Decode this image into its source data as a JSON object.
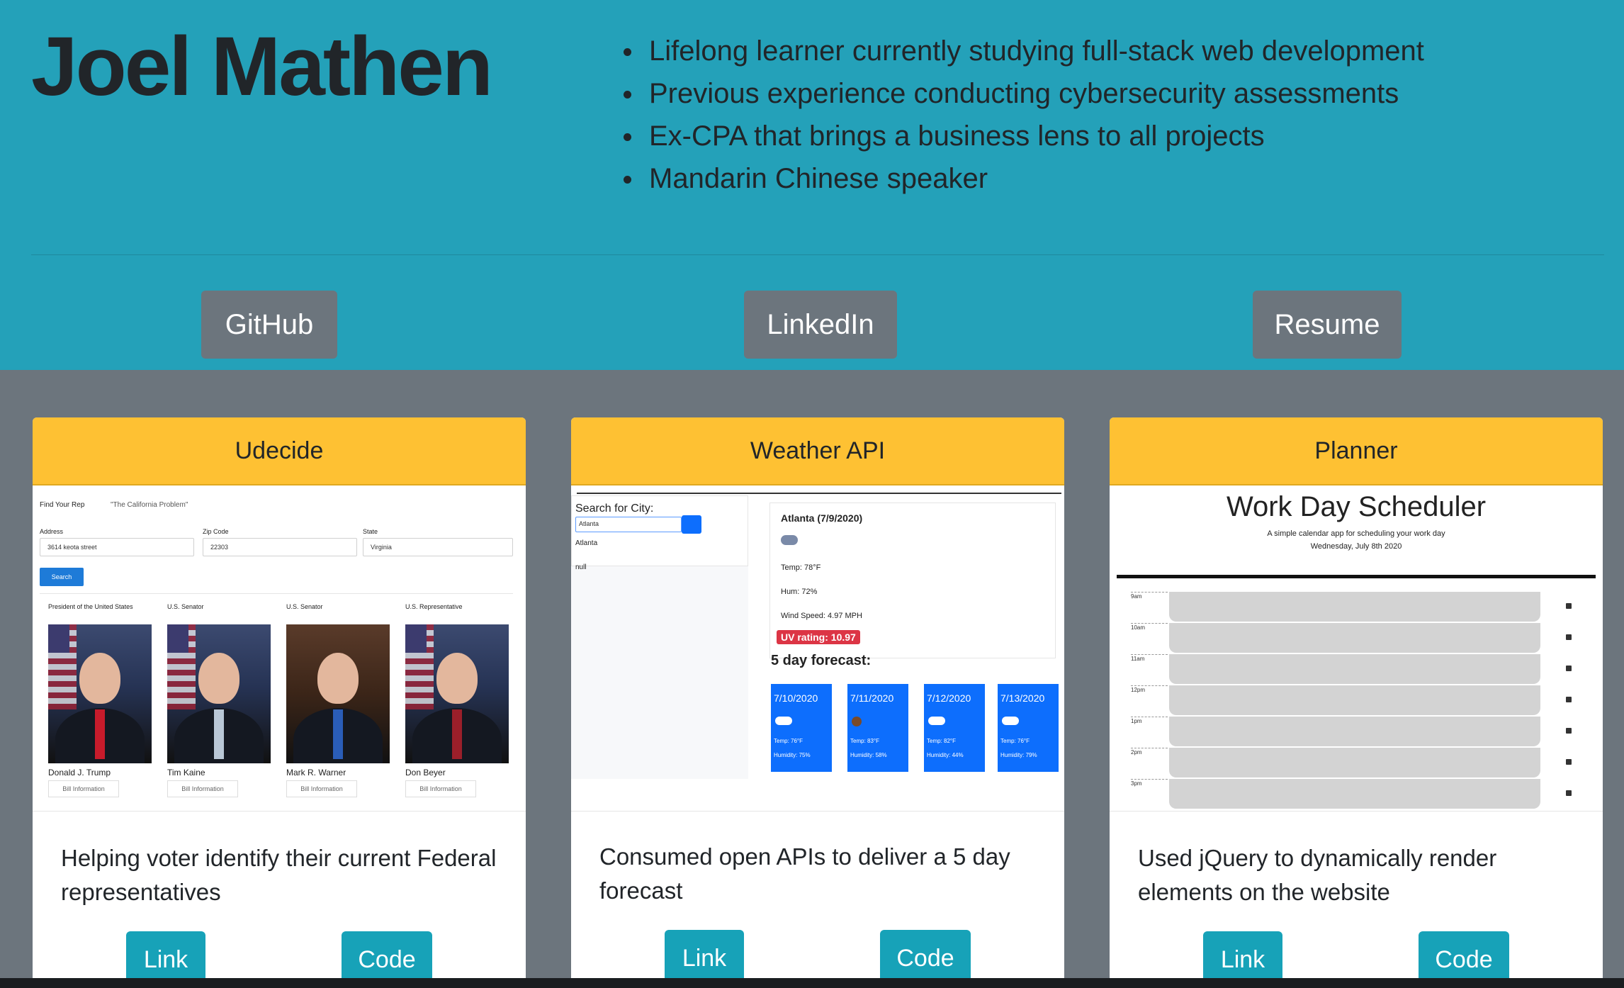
{
  "header": {
    "name": "Joel Mathen",
    "bullets": [
      "Lifelong learner currently studying full-stack web development",
      "Previous experience conducting cybersecurity assessments",
      "Ex-CPA that brings a business lens to all projects",
      "Mandarin Chinese speaker"
    ],
    "buttons": {
      "github": "GitHub",
      "linkedin": "LinkedIn",
      "resume": "Resume"
    }
  },
  "colors": {
    "hero": "#24a1b9",
    "page": "#6c757d",
    "card_header": "#fec133",
    "teal_button": "#17a2b8",
    "gray_button": "#6c757d"
  },
  "projects": [
    {
      "title": "Udecide",
      "description": "Helping voter identify their current Federal representatives",
      "link_label": "Link",
      "code_label": "Code",
      "preview": {
        "tabs": [
          "Find Your Rep",
          "\"The California Problem\""
        ],
        "fields": [
          {
            "label": "Address",
            "value": "3614 keota street"
          },
          {
            "label": "Zip Code",
            "value": "22303"
          },
          {
            "label": "State",
            "value": "Virginia"
          }
        ],
        "search_button": "Search",
        "reps": [
          {
            "office": "President of the United States",
            "name": "Donald J. Trump",
            "button": "Bill Information"
          },
          {
            "office": "U.S. Senator",
            "name": "Tim Kaine",
            "button": "Bill Information"
          },
          {
            "office": "U.S. Senator",
            "name": "Mark R. Warner",
            "button": "Bill Information"
          },
          {
            "office": "U.S. Representative",
            "name": "Don Beyer",
            "button": "Bill Information"
          }
        ]
      }
    },
    {
      "title": "Weather API",
      "description": "Consumed open APIs to deliver a 5 day forecast",
      "link_label": "Link",
      "code_label": "Code",
      "preview": {
        "search_label": "Search for City:",
        "search_value": "Atlanta",
        "history": [
          "Atlanta",
          "null"
        ],
        "city_date": "Atlanta (7/9/2020)",
        "temp": "Temp: 78°F",
        "hum": "Hum: 72%",
        "wind": "Wind Speed: 4.97 MPH",
        "uv": "UV rating: 10.97",
        "forecast_title": "5 day forecast:",
        "forecast": [
          {
            "date": "7/10/2020",
            "temp": "Temp: 76°F",
            "hum": "Humidity: 75%"
          },
          {
            "date": "7/11/2020",
            "temp": "Temp: 83°F",
            "hum": "Humidity: 58%"
          },
          {
            "date": "7/12/2020",
            "temp": "Temp: 82°F",
            "hum": "Humidity: 44%"
          },
          {
            "date": "7/13/2020",
            "temp": "Temp: 76°F",
            "hum": "Humidity: 79%"
          }
        ]
      }
    },
    {
      "title": "Planner",
      "description": "Used jQuery to dynamically render elements on the website",
      "link_label": "Link",
      "code_label": "Code",
      "preview": {
        "title": "Work Day Scheduler",
        "subtitle": "A simple calendar app for scheduling your work day",
        "date": "Wednesday, July 8th 2020",
        "hours": [
          "9am",
          "10am",
          "11am",
          "12pm",
          "1pm",
          "2pm",
          "3pm"
        ]
      }
    }
  ]
}
